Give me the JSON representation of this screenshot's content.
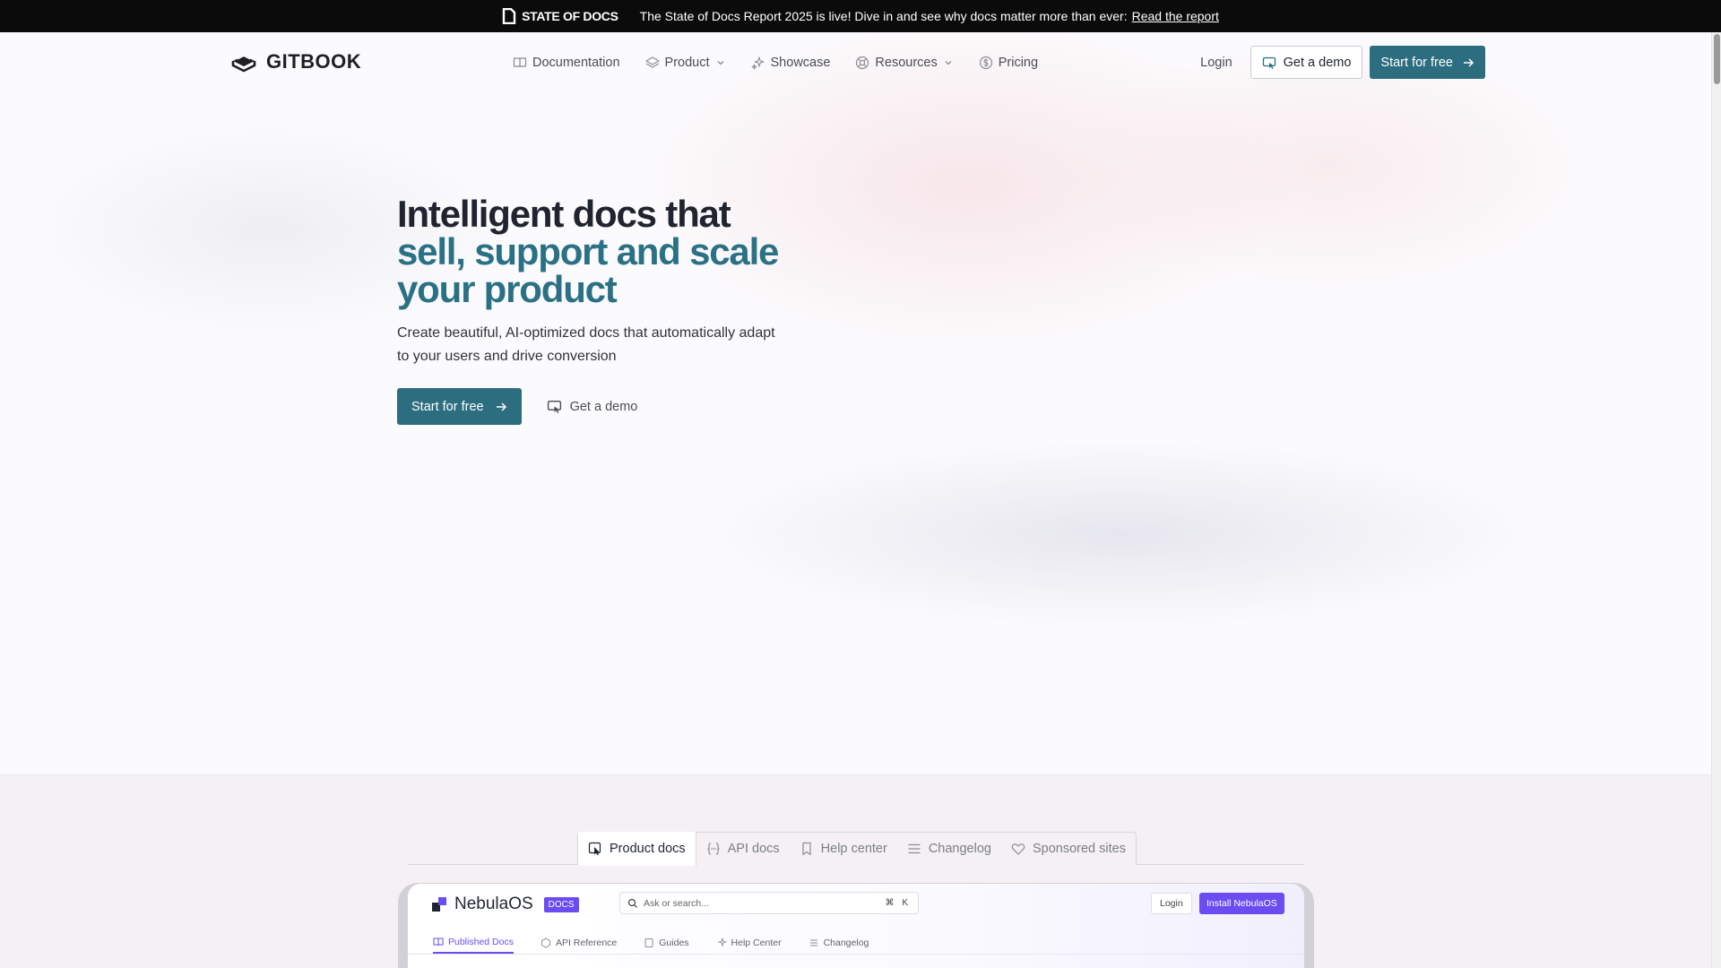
{
  "announcement": {
    "logo_text": "STATE OF DOCS",
    "message": "The State of Docs Report 2025 is live! Dive in and see why docs matter more than ever:",
    "link_label": "Read the report"
  },
  "nav": {
    "brand": "GITBOOK",
    "links": [
      {
        "label": "Documentation",
        "icon": "book-icon"
      },
      {
        "label": "Product",
        "icon": "layers-icon",
        "dropdown": true
      },
      {
        "label": "Showcase",
        "icon": "sparkle-icon"
      },
      {
        "label": "Resources",
        "icon": "lifebuoy-icon",
        "dropdown": true
      },
      {
        "label": "Pricing",
        "icon": "dollar-icon"
      }
    ],
    "login_label": "Login",
    "demo_label": "Get a demo",
    "start_label": "Start for free"
  },
  "hero": {
    "title_line1": "Intelligent docs that",
    "title_line2": "sell, support and scale",
    "title_line3": "your product",
    "subtitle": "Create beautiful, AI-optimized docs that automatically adapt to your users and drive conversion",
    "start_label": "Start for free",
    "demo_label": "Get a demo"
  },
  "showcase_tabs": [
    {
      "label": "Product docs",
      "icon": "cursor-icon",
      "active": true
    },
    {
      "label": "API docs",
      "icon": "braces-icon",
      "active": false
    },
    {
      "label": "Help center",
      "icon": "bookmark-icon",
      "active": false
    },
    {
      "label": "Changelog",
      "icon": "list-icon",
      "active": false
    },
    {
      "label": "Sponsored sites",
      "icon": "heart-icon",
      "active": false
    }
  ],
  "preview": {
    "brand": "NebulaOS",
    "badge": "DOCS",
    "search_placeholder": "Ask or search...",
    "search_shortcut": "⌘ K",
    "login_label": "Login",
    "install_label": "Install NebulaOS",
    "tabs": [
      {
        "label": "Published Docs",
        "active": true
      },
      {
        "label": "API Reference",
        "active": false
      },
      {
        "label": "Guides",
        "active": false
      },
      {
        "label": "Help Center",
        "active": false
      },
      {
        "label": "Changelog",
        "active": false
      }
    ]
  },
  "colors": {
    "accent": "#2c6e80",
    "title_teal": "#2b7186",
    "preview_purple": "#6a4cf0"
  }
}
